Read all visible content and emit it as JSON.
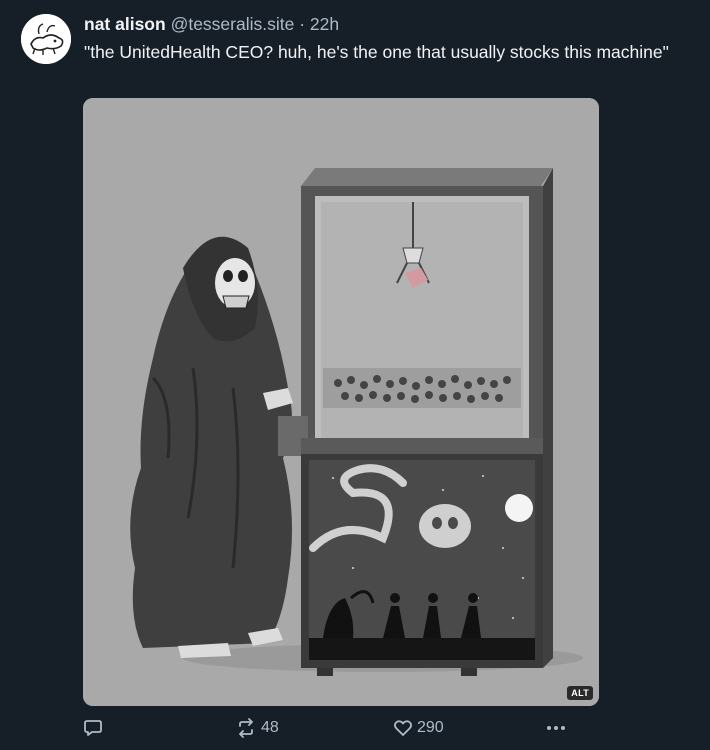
{
  "post": {
    "author_name": "nat alison",
    "author_handle": "@tesseralis.site",
    "separator": "·",
    "timestamp": "22h",
    "text": "\"the UnitedHealth CEO? huh, he's the one that usually stocks this machine\""
  },
  "media": {
    "alt_badge": "ALT"
  },
  "actions": {
    "repost_count": "48",
    "like_count": "290"
  },
  "icons": {
    "reply": "speech-bubble-icon",
    "repost": "repost-arrows-icon",
    "like": "heart-icon",
    "more": "ellipsis-icon"
  },
  "colors": {
    "background": "#161e27",
    "primary_text": "#f1f3f5",
    "secondary_text": "#aebbc9"
  }
}
